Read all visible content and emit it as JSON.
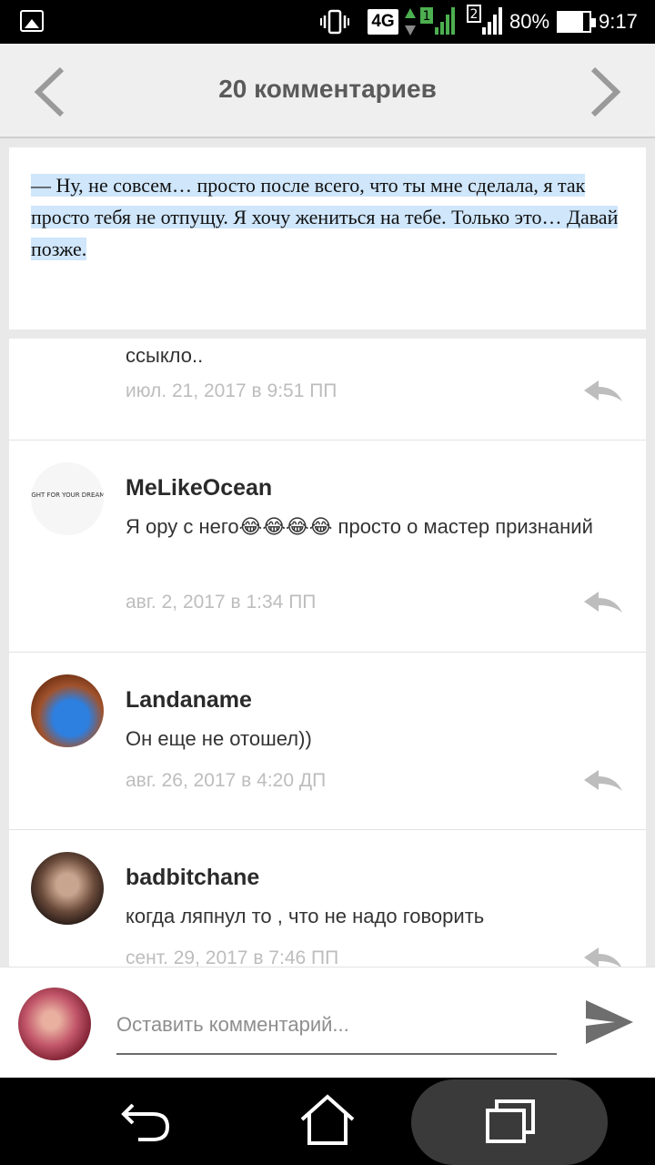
{
  "status_bar": {
    "network": "4G",
    "sim1_badge": "1",
    "sim2_badge": "2",
    "battery_text": "80%",
    "battery_level": 0.8,
    "time": "9:17",
    "icons": [
      "gallery-icon",
      "vibrate-icon",
      "signal-icon",
      "battery-icon"
    ]
  },
  "header": {
    "title": "20 комментариев",
    "back_icon": "chevron-left-icon",
    "next_icon": "chevron-right-icon"
  },
  "quote": {
    "text": "— Ну, не совсем… просто после всего, что ты мне сделала, я так просто тебя не отпущу. Я хочу жениться на тебе. Только это… Давай позже."
  },
  "comments": [
    {
      "name": "",
      "text": "ссыкло..",
      "date": "июл. 21, 2017 в 9:51 ПП"
    },
    {
      "name": "MeLikeOcean",
      "text": "Я ору с него😂😂😂😂 просто о мастер признаний",
      "date": "авг. 2, 2017 в 1:34 ПП",
      "avatar_text": "FIGHT FOR YOUR DREAMS"
    },
    {
      "name": "Landaname",
      "text": "Он еще не отошел))",
      "date": "авг. 26, 2017 в 4:20 ДП"
    },
    {
      "name": "badbitchane",
      "text": "когда ляпнул то , что не надо говорить",
      "date": "сент. 29, 2017 в 7:46 ПП"
    }
  ],
  "compose": {
    "placeholder": "Оставить комментарий..."
  },
  "colors": {
    "highlight": "#cfe6fb",
    "header_bg": "#efefef",
    "date_gray": "#bdbdbd"
  }
}
